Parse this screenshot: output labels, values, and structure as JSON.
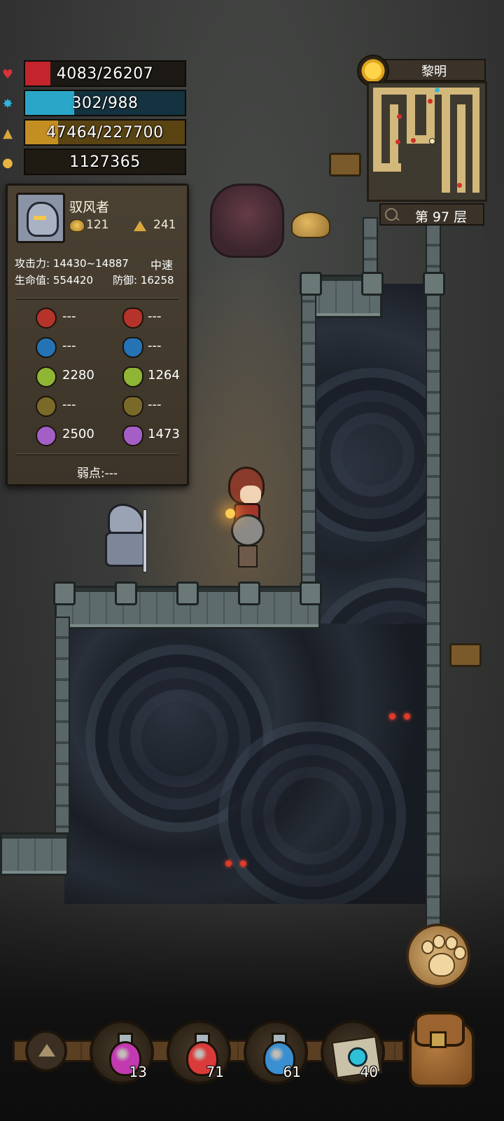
{
  "hud": {
    "hp": {
      "text": "4083/26207",
      "fraction": 0.156,
      "color": "#c4242b",
      "icon": "heart-icon"
    },
    "mp": {
      "text": "302/988",
      "fraction": 0.306,
      "color": "#2aa7c8",
      "icon": "mana-icon"
    },
    "exp": {
      "text": "47464/227700",
      "fraction": 0.208,
      "color": "#c48f22",
      "icon": "experience-icon"
    },
    "gold": {
      "text": "1127365",
      "icon": "gold-icon"
    }
  },
  "enemy_panel": {
    "name": "驭风者",
    "gold_reward": "121",
    "exp_reward": "241",
    "attack": "攻击力: 14430~14887",
    "speed": "中速",
    "hp": "生命值: 554420",
    "defense": "防御: 16258",
    "resistances": [
      {
        "left_icon": "fire-drop-icon",
        "left": "---",
        "right_icon": "fire-shield-icon",
        "right": "---",
        "color": "#b5332a"
      },
      {
        "left_icon": "water-drop-icon",
        "left": "---",
        "right_icon": "water-shield-icon",
        "right": "---",
        "color": "#2573b5"
      },
      {
        "left_icon": "wind-leaf-icon",
        "left": "2280",
        "right_icon": "wind-shield-icon",
        "right": "1264",
        "color": "#8fb535"
      },
      {
        "left_icon": "earth-icon",
        "left": "---",
        "right_icon": "earth-shield-icon",
        "right": "---",
        "color": "#7a6a2a"
      },
      {
        "left_icon": "arcane-orb-icon",
        "left": "2500",
        "right_icon": "arcane-shield-icon",
        "right": "1473",
        "color": "#a45fc7"
      }
    ],
    "weakness": "弱点:---"
  },
  "minimap": {
    "time_of_day": "黎明",
    "floor": "第 97 层",
    "path_color": "#d2b87a"
  },
  "toolbar": {
    "slots": [
      {
        "name": "purple-potion",
        "count": "13",
        "color": "#c23ab0"
      },
      {
        "name": "red-potion",
        "count": "71",
        "color": "#d93a3a"
      },
      {
        "name": "blue-potion",
        "count": "61",
        "color": "#3a8fd0"
      },
      {
        "name": "map-scroll",
        "count": "40",
        "color": "#2fc0d9"
      }
    ]
  }
}
